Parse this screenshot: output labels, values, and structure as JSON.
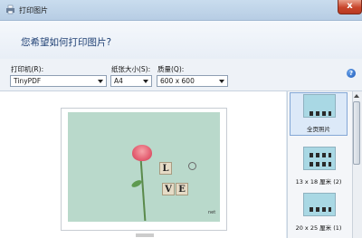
{
  "window": {
    "title": "打印图片",
    "close_label": "x"
  },
  "header": {
    "prompt": "您希望如何打印图片?"
  },
  "controls": {
    "printer": {
      "label": "打印机(R):",
      "value": "TinyPDF"
    },
    "paper_size": {
      "label": "纸张大小(S):",
      "value": "A4"
    },
    "quality": {
      "label": "质量(Q):",
      "value": "600 x 600"
    },
    "help_label": "?"
  },
  "preview": {
    "tiles": [
      "L",
      "V",
      "E"
    ],
    "watermark": "net"
  },
  "layouts": [
    {
      "label": "全页照片"
    },
    {
      "label": "13 x 18 厘米 (2)"
    },
    {
      "label": "20 x 25 厘米 (1)"
    }
  ]
}
